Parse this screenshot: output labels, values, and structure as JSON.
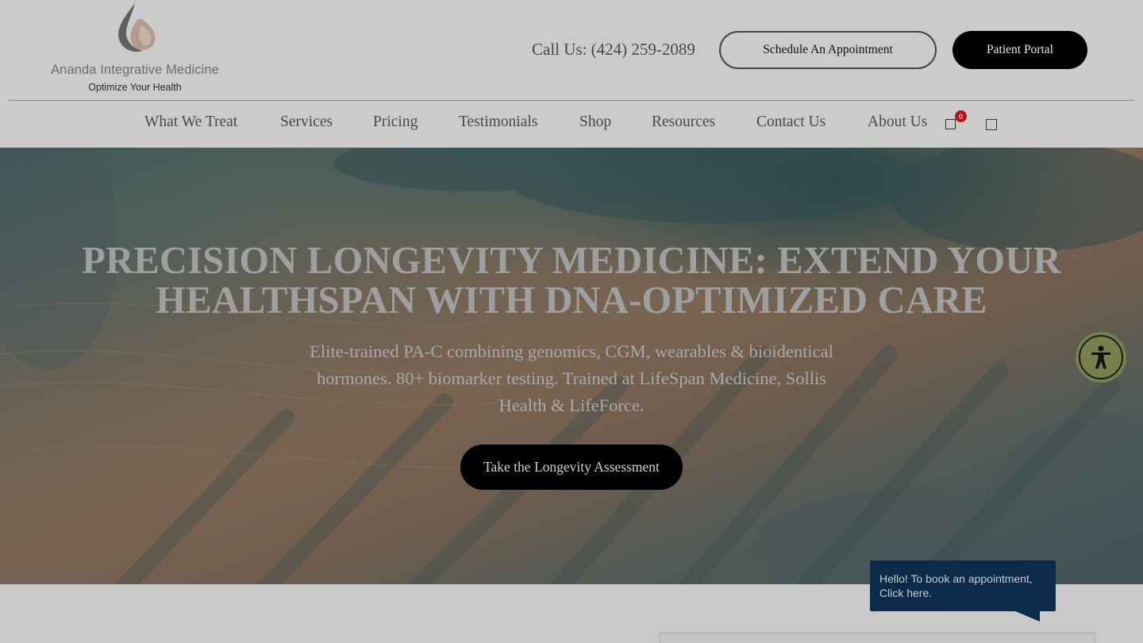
{
  "header": {
    "logo_name": "Ananda Integrative Medicine",
    "logo_tagline": "Optimize Your Health",
    "call_us": "Call Us: (424) 259-2089",
    "schedule_label": "Schedule An Appointment",
    "portal_label": "Patient Portal"
  },
  "nav": {
    "items": [
      {
        "label": "What We Treat"
      },
      {
        "label": "Services"
      },
      {
        "label": "Pricing"
      },
      {
        "label": "Testimonials"
      },
      {
        "label": "Shop"
      },
      {
        "label": "Resources"
      },
      {
        "label": "Contact Us"
      },
      {
        "label": "About Us"
      }
    ],
    "cart_count": "0",
    "cart_icon": "cart-icon",
    "search_icon": "search-icon"
  },
  "hero": {
    "title": "PRECISION LONGEVITY MEDICINE: EXTEND YOUR HEALTHSPAN WITH DNA-OPTIMIZED CARE",
    "subtitle": "Elite-trained PA-C combining genomics, CGM, wearables & bioidentical hormones. 80+ biomarker testing. Trained at LifeSpan Medicine, Sollis Health & LifeForce.",
    "cta_label": "Take the Longevity Assessment"
  },
  "chat": {
    "message": "Hello! To book an appointment, Click here."
  },
  "colors": {
    "overlay_gray": "#c9c9c9",
    "button_black": "#000000",
    "chat_navy": "#0c2a4a",
    "badge_red": "#b3141c",
    "accessibility_olive": "#77804a"
  }
}
